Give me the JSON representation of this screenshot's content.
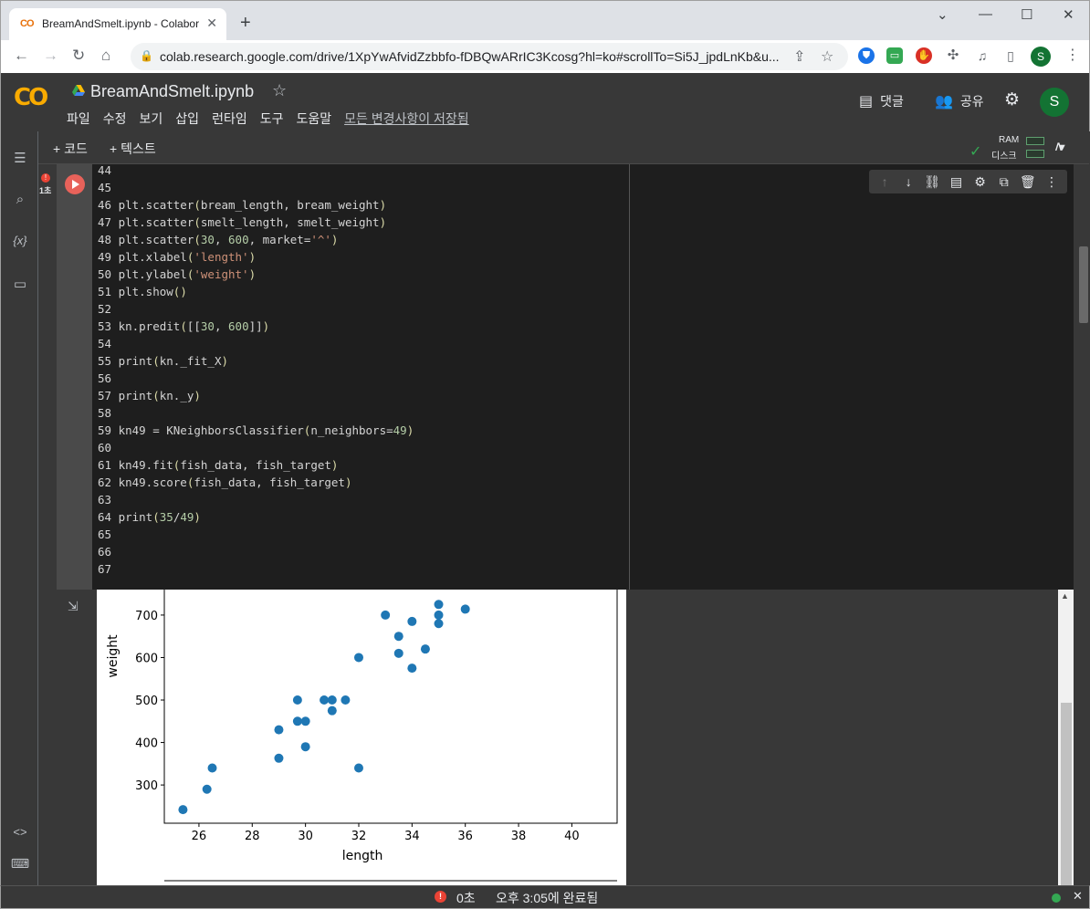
{
  "browser": {
    "tab_title": "BreamAndSmelt.ipynb - Colabor",
    "tab_favicon": "CO",
    "url": "colab.research.google.com/drive/1XpYwAfvidZzbbfo-fDBQwARrIC3Kcosg?hl=ko#scrollTo=Si5J_jpdLnKb&u...",
    "profile_initial": "S"
  },
  "colab": {
    "logo": "CO",
    "title": "BreamAndSmelt.ipynb",
    "menu": [
      "파일",
      "수정",
      "보기",
      "삽입",
      "런타임",
      "도구",
      "도움말"
    ],
    "saved_status": "모든 변경사항이 저장됨",
    "comment_label": "댓글",
    "share_label": "공유",
    "avatar_initial": "S"
  },
  "toolbar": {
    "add_code": "+ 코드",
    "add_text": "+ 텍스트",
    "ram_label": "RAM",
    "disk_label": "디스크"
  },
  "cell": {
    "error_time": "1초",
    "lines": [
      {
        "n": "44",
        "code": ""
      },
      {
        "n": "45",
        "code": ""
      },
      {
        "n": "46",
        "code": "plt.scatter(bream_length, bream_weight)"
      },
      {
        "n": "47",
        "code": "plt.scatter(smelt_length, smelt_weight)"
      },
      {
        "n": "48",
        "code": "plt.scatter(30, 600, market='^')"
      },
      {
        "n": "49",
        "code": "plt.xlabel('length')"
      },
      {
        "n": "50",
        "code": "plt.ylabel('weight')"
      },
      {
        "n": "51",
        "code": "plt.show()"
      },
      {
        "n": "52",
        "code": ""
      },
      {
        "n": "53",
        "code": "kn.predit([[30, 600]])"
      },
      {
        "n": "54",
        "code": ""
      },
      {
        "n": "55",
        "code": "print(kn._fit_X)"
      },
      {
        "n": "56",
        "code": ""
      },
      {
        "n": "57",
        "code": "print(kn._y)"
      },
      {
        "n": "58",
        "code": ""
      },
      {
        "n": "59",
        "code": "kn49 = KNeighborsClassifier(n_neighbors=49)"
      },
      {
        "n": "60",
        "code": ""
      },
      {
        "n": "61",
        "code": "kn49.fit(fish_data, fish_target)"
      },
      {
        "n": "62",
        "code": "kn49.score(fish_data, fish_target)"
      },
      {
        "n": "63",
        "code": ""
      },
      {
        "n": "64",
        "code": "print(35/49)"
      },
      {
        "n": "65",
        "code": ""
      },
      {
        "n": "66",
        "code": ""
      },
      {
        "n": "67",
        "code": ""
      }
    ]
  },
  "chart_data": {
    "type": "scatter",
    "xlabel": "length",
    "ylabel": "weight",
    "xlim": [
      24.7,
      41.7
    ],
    "ylim": [
      210,
      760
    ],
    "xticks": [
      26,
      28,
      30,
      32,
      34,
      36,
      38,
      40
    ],
    "yticks": [
      300,
      400,
      500,
      600,
      700
    ],
    "color": "#1f77b4",
    "points": [
      [
        25.4,
        242
      ],
      [
        26.3,
        290
      ],
      [
        26.5,
        340
      ],
      [
        29.0,
        363
      ],
      [
        29.0,
        430
      ],
      [
        29.7,
        450
      ],
      [
        29.7,
        500
      ],
      [
        30.0,
        390
      ],
      [
        30.0,
        450
      ],
      [
        30.7,
        500
      ],
      [
        31.0,
        475
      ],
      [
        31.0,
        500
      ],
      [
        31.5,
        500
      ],
      [
        32.0,
        340
      ],
      [
        32.0,
        600
      ],
      [
        33.0,
        700
      ],
      [
        33.5,
        610
      ],
      [
        33.5,
        650
      ],
      [
        34.0,
        575
      ],
      [
        34.0,
        685
      ],
      [
        34.5,
        620
      ],
      [
        35.0,
        680
      ],
      [
        35.0,
        700
      ],
      [
        35.0,
        725
      ],
      [
        36.0,
        714
      ]
    ]
  },
  "status": {
    "error_icon": "!",
    "duration": "0초",
    "completed": "오후 3:05에 완료됨"
  }
}
